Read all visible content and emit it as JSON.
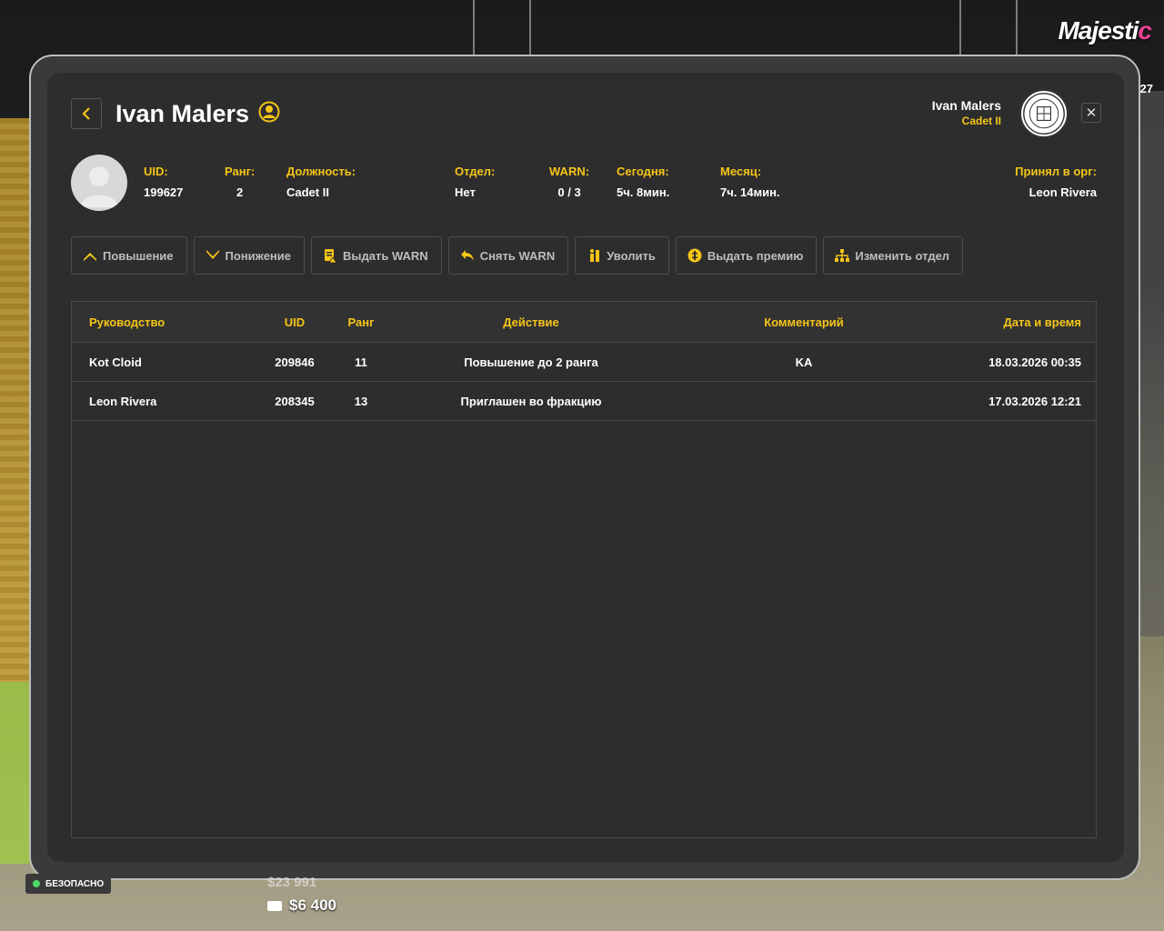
{
  "hud": {
    "brand_main": "Majesti",
    "brand_accent": "c",
    "corner_number": "27",
    "safe_zone": "БЕЗОПАСНО",
    "cash": "$23 991",
    "bank": "$6 400"
  },
  "header": {
    "title": "Ivan Malers",
    "current_user_name": "Ivan Malers",
    "current_user_rank": "Cadet II"
  },
  "profile": {
    "fields": [
      {
        "label": "UID:",
        "value": "199627"
      },
      {
        "label": "Ранг:",
        "value": "2"
      },
      {
        "label": "Должность:",
        "value": "Cadet II"
      },
      {
        "label": "Отдел:",
        "value": "Нет"
      },
      {
        "label": "WARN:",
        "value": "0 / 3"
      },
      {
        "label": "Сегодня:",
        "value": "5ч. 8мин."
      },
      {
        "label": "Месяц:",
        "value": "7ч. 14мин."
      },
      {
        "label": "Принял в орг:",
        "value": "Leon Rivera"
      }
    ]
  },
  "actions": [
    {
      "label": "Повышение",
      "icon": "chevron-up-icon"
    },
    {
      "label": "Понижение",
      "icon": "chevron-down-icon"
    },
    {
      "label": "Выдать WARN",
      "icon": "warn-document-icon"
    },
    {
      "label": "Снять WARN",
      "icon": "undo-arrow-icon"
    },
    {
      "label": "Уволить",
      "icon": "fire-person-icon"
    },
    {
      "label": "Выдать премию",
      "icon": "coin-icon"
    },
    {
      "label": "Изменить отдел",
      "icon": "hierarchy-icon"
    }
  ],
  "log_table": {
    "columns": [
      "Руководство",
      "UID",
      "Ранг",
      "Действие",
      "Комментарий",
      "Дата и время"
    ],
    "rows": [
      [
        "Kot Cloid",
        "209846",
        "11",
        "Повышение до 2 ранга",
        "KA",
        "18.03.2026 00:35"
      ],
      [
        "Leon Rivera",
        "208345",
        "13",
        "Приглашен во фракцию",
        "",
        "17.03.2026 12:21"
      ]
    ]
  },
  "colors": {
    "accent": "#f5c518",
    "panel": "#2d2d2d",
    "frame": "#3a3a3a",
    "text": "#ffffff",
    "muted": "#bdbdbd"
  }
}
